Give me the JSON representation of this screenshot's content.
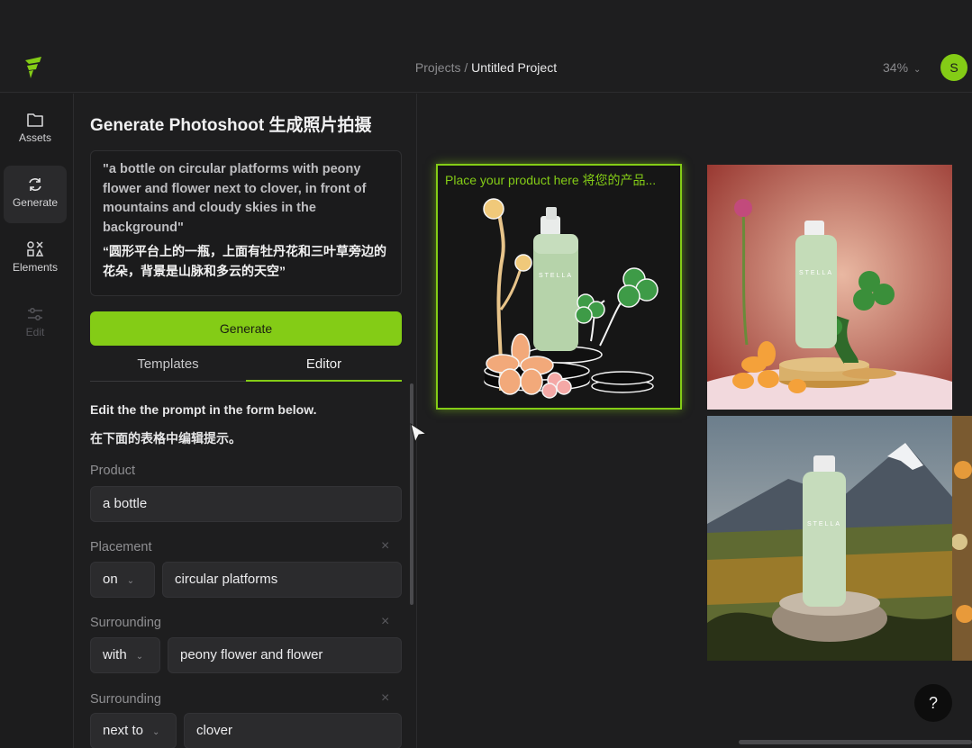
{
  "header": {
    "breadcrumb_root": "Projects",
    "breadcrumb_sep": " / ",
    "project_title": "Untitled Project",
    "zoom_level": "34%",
    "avatar_initial": "S"
  },
  "rail": {
    "items": [
      {
        "label": "Assets",
        "icon": "folder-icon"
      },
      {
        "label": "Generate",
        "icon": "refresh-icon"
      },
      {
        "label": "Elements",
        "icon": "elements-icon"
      },
      {
        "label": "Edit",
        "icon": "sliders-icon"
      }
    ]
  },
  "panel": {
    "title": "Generate Photoshoot 生成照片拍摄",
    "prompt_en": "\"a bottle on circular platforms with peony flower and flower next to clover, in front of mountains and cloudy skies in the background\"",
    "prompt_zh": "“圆形平台上的一瓶，上面有牡丹花和三叶草旁边的花朵，背景是山脉和多云的天空”",
    "generate_label": "Generate",
    "tabs": [
      {
        "label": "Templates"
      },
      {
        "label": "Editor"
      }
    ],
    "instructions_en": "Edit the the prompt in the form below.",
    "instructions_zh": "在下面的表格中编辑提示。",
    "fields": {
      "product": {
        "label": "Product",
        "value": "a bottle"
      },
      "placement": {
        "label": "Placement",
        "preposition": "on",
        "value": "circular platforms"
      },
      "surrounding1": {
        "label": "Surrounding",
        "preposition": "with",
        "value": "peony flower and flower"
      },
      "surrounding2": {
        "label": "Surrounding",
        "preposition": "next to",
        "value": "clover"
      }
    },
    "remove_icon": "×"
  },
  "canvas": {
    "frame_label": "Place your product here 将您的产品...",
    "product_text": "STELLA",
    "help_label": "?"
  },
  "colors": {
    "accent": "#84cc16",
    "background": "#1e1e1f",
    "input_bg": "#2b2b2d"
  }
}
